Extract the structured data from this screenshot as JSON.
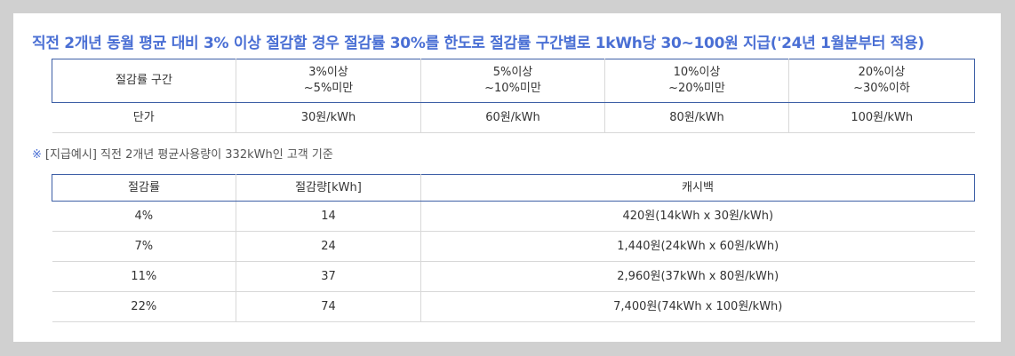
{
  "heading": "직전 2개년 동월 평균 대비 3% 이상 절감할 경우 절감률 30%를 한도로 절감률 구간별로 1kWh당 30~100원 지급('24년 1월분부터 적용)",
  "rate_table": {
    "headers": [
      {
        "line1": "절감률 구간",
        "line2": ""
      },
      {
        "line1": "3%이상",
        "line2": "~5%미만"
      },
      {
        "line1": "5%이상",
        "line2": "~10%미만"
      },
      {
        "line1": "10%이상",
        "line2": "~20%미만"
      },
      {
        "line1": "20%이상",
        "line2": "~30%이하"
      }
    ],
    "row": [
      "단가",
      "30원/kWh",
      "60원/kWh",
      "80원/kWh",
      "100원/kWh"
    ]
  },
  "note": {
    "mark": "※",
    "text": "[지급예시] 직전 2개년 평균사용량이 332kWh인 고객 기준"
  },
  "example_table": {
    "headers": [
      "절감률",
      "절감량[kWh]",
      "캐시백"
    ],
    "rows": [
      [
        "4%",
        "14",
        "420원(14kWh x 30원/kWh)"
      ],
      [
        "7%",
        "24",
        "1,440원(24kWh x 60원/kWh)"
      ],
      [
        "11%",
        "37",
        "2,960원(37kWh x 80원/kWh)"
      ],
      [
        "22%",
        "74",
        "7,400원(74kWh x 100원/kWh)"
      ]
    ]
  }
}
